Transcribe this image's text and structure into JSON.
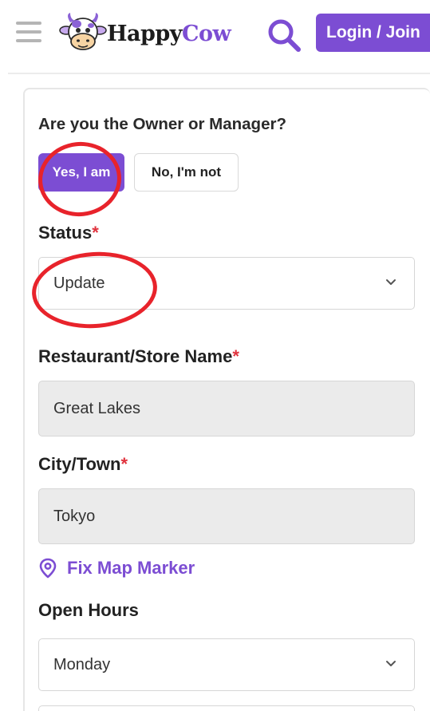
{
  "header": {
    "brand_happy": "Happy",
    "brand_cow": "Cow",
    "login_label": "Login / Join",
    "icons": {
      "menu": "hamburger-menu-icon",
      "search": "search-icon",
      "logo": "cow-logo-icon"
    }
  },
  "form": {
    "owner_question": "Are you the Owner or Manager?",
    "owner_yes": "Yes, I am",
    "owner_no": "No, I'm not",
    "status_label": "Status",
    "status_value": "Update",
    "name_label": "Restaurant/Store Name",
    "name_value": "Great Lakes",
    "city_label": "City/Town",
    "city_value": "Tokyo",
    "fix_marker_label": "Fix Map Marker",
    "hours_label": "Open Hours",
    "day_value": "Monday",
    "required_mark": "*"
  },
  "colors": {
    "brand_purple": "#7c4dd3",
    "required_red": "#e0323d",
    "annotation_red": "#e8232b"
  }
}
